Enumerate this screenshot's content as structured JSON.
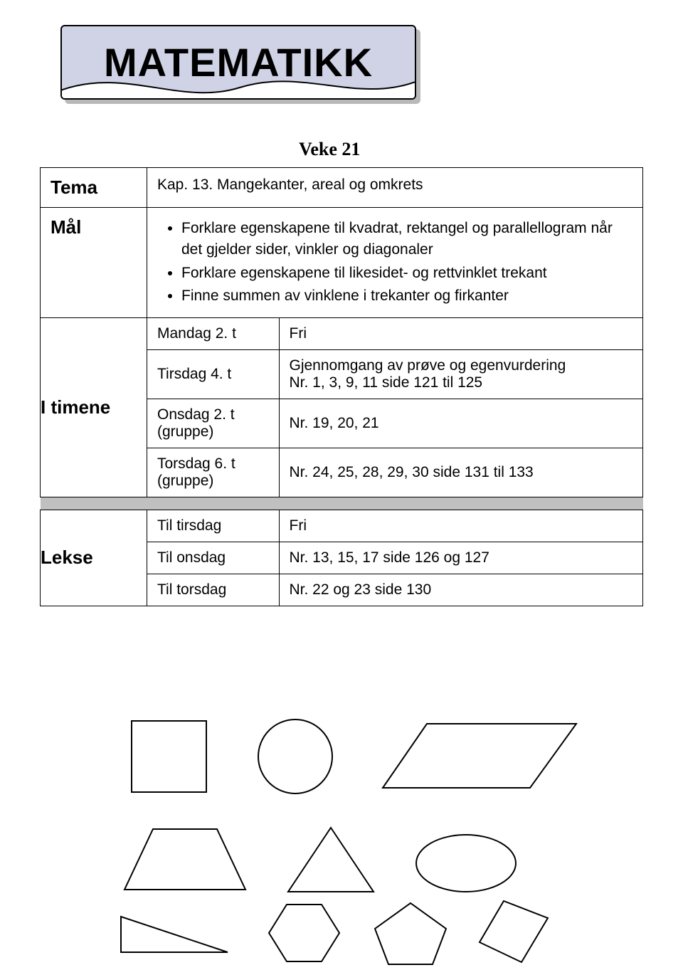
{
  "title": "MATEMATIKK",
  "veke": "Veke 21",
  "rows": {
    "tema": {
      "label": "Tema",
      "value": "Kap. 13. Mangekanter, areal og omkrets"
    },
    "maal": {
      "label": "Mål",
      "bullets": [
        "Forklare egenskapene til kvadrat, rektangel og parallellogram når det gjelder sider, vinkler og diagonaler",
        "Forklare egenskapene til likesidet- og rettvinklet trekant",
        "Finne summen av vinklene i trekanter og firkanter"
      ]
    },
    "itimene": {
      "label": "I timene",
      "rows": [
        {
          "col1": "Mandag 2. t",
          "col2": "Fri"
        },
        {
          "col1": "Tirsdag 4. t",
          "col2_line1": "Gjennomgang av prøve og egenvurdering",
          "col2_line2": "Nr. 1, 3, 9, 11 side 121 til 125"
        },
        {
          "col1_line1": "Onsdag 2. t",
          "col1_line2": "(gruppe)",
          "col2": "Nr. 19, 20, 21"
        },
        {
          "col1_line1": "Torsdag 6. t",
          "col1_line2": "(gruppe)",
          "col2": "Nr. 24, 25, 28, 29, 30 side 131 til 133"
        }
      ]
    },
    "lekse": {
      "label": "Lekse",
      "rows": [
        {
          "col1": "Til tirsdag",
          "col2": "Fri"
        },
        {
          "col1": "Til onsdag",
          "col2": "Nr. 13, 15, 17 side 126 og 127"
        },
        {
          "col1": "Til torsdag",
          "col2": "Nr. 22 og 23 side 130"
        }
      ]
    }
  }
}
